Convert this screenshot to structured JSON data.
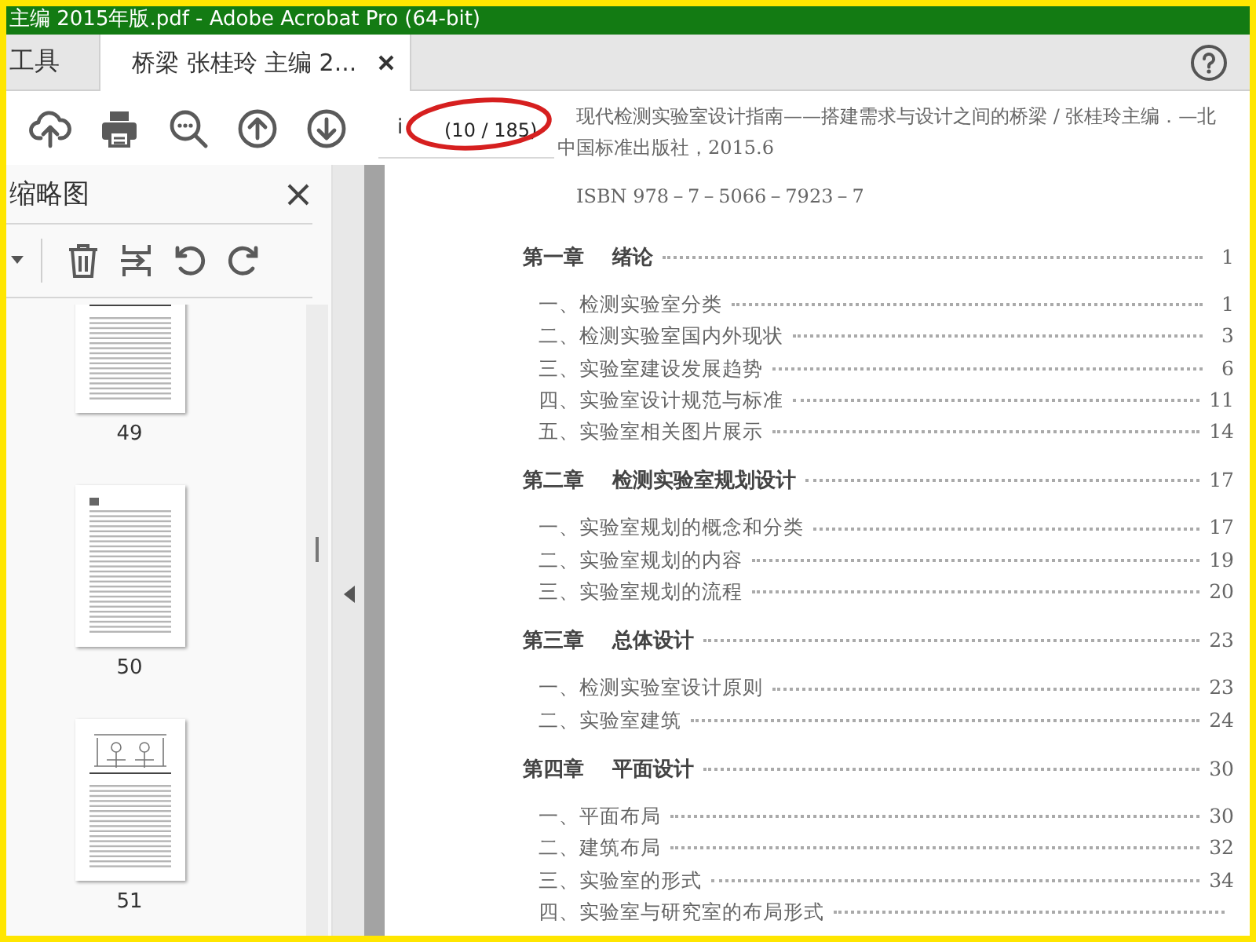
{
  "window": {
    "title": "主编 2015年版.pdf - Adobe Acrobat Pro (64-bit)"
  },
  "tabs": [
    {
      "label": "工具",
      "selected": false,
      "closable": false
    },
    {
      "label": "桥梁 张桂玲 主编 2...",
      "selected": true,
      "closable": true
    }
  ],
  "toolbar": {
    "page_field": {
      "value": "i"
    },
    "page_count": "(10 / 185)",
    "highlight": {
      "kind": "ellipse"
    }
  },
  "thumbnails_panel": {
    "title": "缩略图",
    "pages": [
      {
        "label": "49",
        "kind": "figure"
      },
      {
        "label": "50",
        "kind": "text"
      },
      {
        "label": "51",
        "kind": "figure"
      }
    ]
  },
  "document": {
    "citation": [
      "现代检测实验室设计指南——搭建需求与设计之间的桥梁 / 张桂玲主编．—北",
      "中国标准出版社，2015.6"
    ],
    "isbn": "ISBN 978－7－5066－7923－7",
    "toc": [
      {
        "number": "第一章",
        "title": "绪论",
        "page": "1",
        "children": [
          {
            "title": "一、检测实验室分类",
            "page": "1"
          },
          {
            "title": "二、检测实验室国内外现状",
            "page": "3"
          },
          {
            "title": "三、实验室建设发展趋势",
            "page": "6"
          },
          {
            "title": "四、实验室设计规范与标准",
            "page": "11"
          },
          {
            "title": "五、实验室相关图片展示",
            "page": "14"
          }
        ]
      },
      {
        "number": "第二章",
        "title": "检测实验室规划设计",
        "page": "17",
        "children": [
          {
            "title": "一、实验室规划的概念和分类",
            "page": "17"
          },
          {
            "title": "二、实验室规划的内容",
            "page": "19"
          },
          {
            "title": "三、实验室规划的流程",
            "page": "20"
          }
        ]
      },
      {
        "number": "第三章",
        "title": "总体设计",
        "page": "23",
        "children": [
          {
            "title": "一、检测实验室设计原则",
            "page": "23"
          },
          {
            "title": "二、实验室建筑",
            "page": "24"
          }
        ]
      },
      {
        "number": "第四章",
        "title": "平面设计",
        "page": "30",
        "children": [
          {
            "title": "一、平面布局",
            "page": "30"
          },
          {
            "title": "二、建筑布局",
            "page": "32"
          },
          {
            "title": "三、实验室的形式",
            "page": "34"
          },
          {
            "title": "四、实验室与研究室的布局形式"
          }
        ]
      }
    ]
  }
}
